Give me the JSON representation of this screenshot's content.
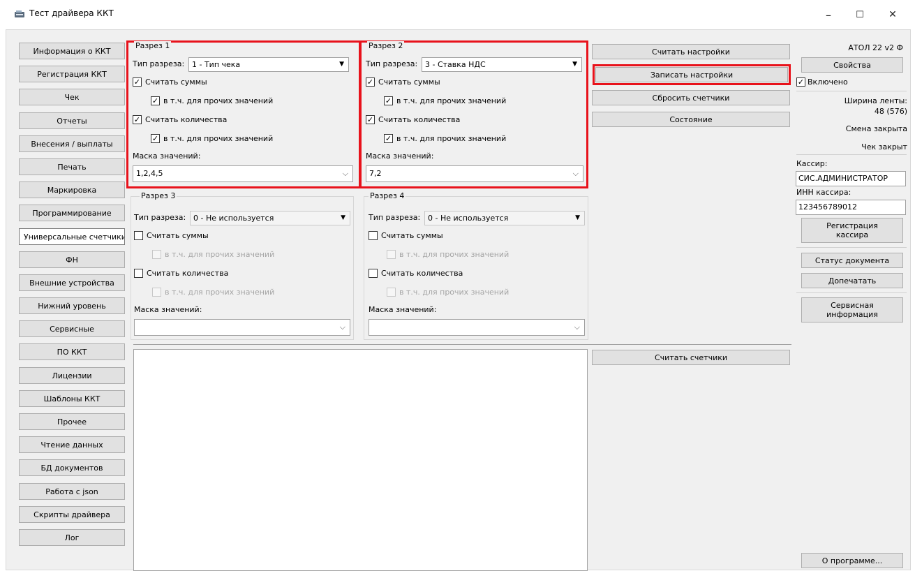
{
  "window": {
    "title": "Тест драйвера ККТ",
    "controls": {
      "minimize": "–",
      "maximize": "☐",
      "close": "✕"
    }
  },
  "nav": {
    "items": [
      "Информация о ККТ",
      "Регистрация ККТ",
      "Чек",
      "Отчеты",
      "Внесения / выплаты",
      "Печать",
      "Маркировка",
      "Программирование",
      "Универсальные счетчики",
      "ФН",
      "Внешние устройства",
      "Нижний уровень",
      "Сервисные",
      "ПО ККТ",
      "Лицензии",
      "Шаблоны ККТ",
      "Прочее",
      "Чтение данных",
      "БД документов",
      "Работа с json",
      "Скрипты драйвера",
      "Лог"
    ],
    "active_index": 8
  },
  "sections": {
    "s1": {
      "title": "Разрез 1",
      "type_label": "Тип разреза:",
      "type_value": "1 - Тип чека",
      "sum_label": "Считать суммы",
      "sum_checked": true,
      "sum_other_label": "в т.ч. для прочих значений",
      "sum_other_checked": true,
      "qty_label": "Считать количества",
      "qty_checked": true,
      "qty_other_label": "в т.ч. для прочих значений",
      "qty_other_checked": true,
      "mask_label": "Маска значений:",
      "mask_value": "1,2,4,5"
    },
    "s2": {
      "title": "Разрез 2",
      "type_label": "Тип разреза:",
      "type_value": "3 - Ставка НДС",
      "sum_label": "Считать суммы",
      "sum_checked": true,
      "sum_other_label": "в т.ч. для прочих значений",
      "sum_other_checked": true,
      "qty_label": "Считать количества",
      "qty_checked": true,
      "qty_other_label": "в т.ч. для прочих значений",
      "qty_other_checked": true,
      "mask_label": "Маска значений:",
      "mask_value": "7,2"
    },
    "s3": {
      "title": "Разрез 3",
      "type_label": "Тип разреза:",
      "type_value": "0 - Не используется",
      "sum_label": "Считать суммы",
      "sum_checked": false,
      "sum_other_label": "в т.ч. для прочих значений",
      "sum_other_checked": false,
      "qty_label": "Считать количества",
      "qty_checked": false,
      "qty_other_label": "в т.ч. для прочих значений",
      "qty_other_checked": false,
      "mask_label": "Маска значений:",
      "mask_value": ""
    },
    "s4": {
      "title": "Разрез 4",
      "type_label": "Тип разреза:",
      "type_value": "0 - Не используется",
      "sum_label": "Считать суммы",
      "sum_checked": false,
      "sum_other_label": "в т.ч. для прочих значений",
      "sum_other_checked": false,
      "qty_label": "Считать количества",
      "qty_checked": false,
      "qty_other_label": "в т.ч. для прочих значений",
      "qty_other_checked": false,
      "mask_label": "Маска значений:",
      "mask_value": ""
    }
  },
  "actions": {
    "read_settings": "Считать настройки",
    "write_settings": "Записать настройки",
    "reset_counters": "Сбросить счетчики",
    "status": "Состояние",
    "read_counters": "Считать счетчики"
  },
  "right_panel": {
    "device": "АТОЛ 22 v2 Ф",
    "properties": "Свойства",
    "enabled_label": "Включено",
    "enabled_checked": true,
    "tape_width": "Ширина ленты:",
    "tape_value": "48 (576)",
    "shift_status": "Смена закрыта",
    "receipt_status": "Чек закрыт",
    "cashier_label": "Кассир:",
    "cashier_value": "СИС.АДМИНИСТРАТОР",
    "inn_label": "ИНН кассира:",
    "inn_value": "123456789012",
    "register_cashier": "Регистрация кассира",
    "doc_status": "Статус документа",
    "reprint": "Допечатать",
    "service_info": "Сервисная информация",
    "about": "О программе..."
  },
  "colors": {
    "highlight": "#e8121b",
    "panel_bg": "#f0f0f0",
    "button_bg": "#e1e1e1"
  }
}
